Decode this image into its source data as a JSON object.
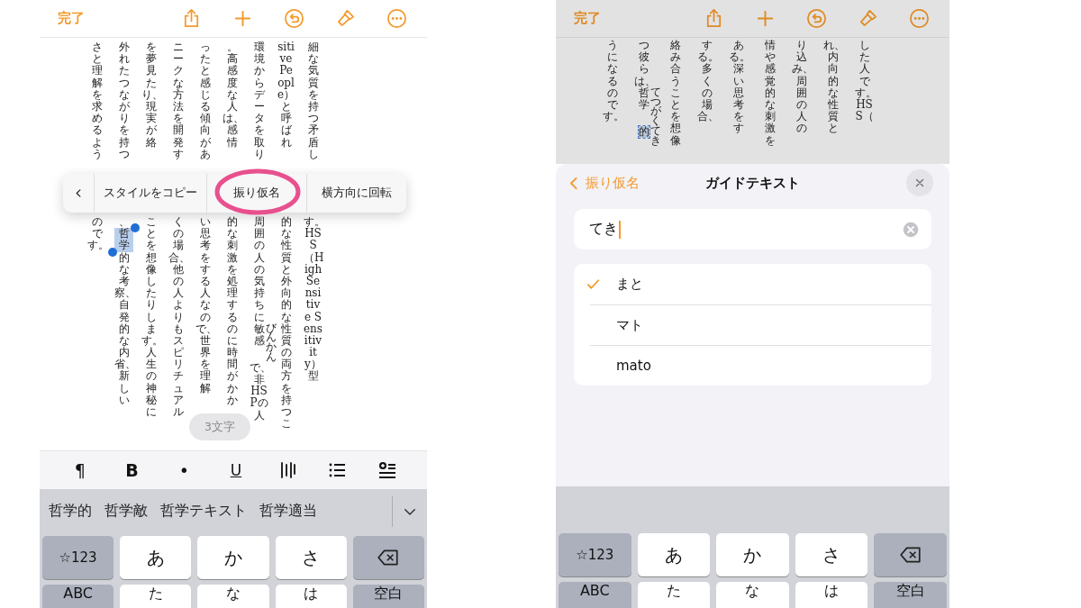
{
  "screens": [
    {
      "dimmed": false,
      "top_bar": {
        "done": "完了"
      },
      "document": {
        "columns": [
          {
            "top": [
              {
                "text": "さと理解を求めるよう"
              }
            ],
            "bottom": [
              {
                "text": "のです。"
              }
            ]
          },
          {
            "top": [
              {
                "text": "外れたつながりを持つ"
              }
            ],
            "bottom": [
              {
                "text": "、",
                "selected": false
              },
              {
                "text": "哲学",
                "selected": true
              },
              {
                "text": "的な考察、自発的な内省、新しい",
                "selected": false
              }
            ]
          },
          {
            "top": [
              {
                "text": "を夢見たり、現実が絡"
              }
            ],
            "bottom": [
              {
                "text": "ことを想像したりします。人生の神秘に"
              }
            ]
          },
          {
            "top": [
              {
                "text": "ニークな方法を開発す"
              }
            ],
            "bottom": [
              {
                "text": "くの場合、他の人よりもスピリチュアル"
              }
            ]
          },
          {
            "top": [
              {
                "text": "ったと感じる傾向があ"
              }
            ],
            "bottom": [
              {
                "text": "い思考をする人なので、世界を理解"
              }
            ]
          },
          {
            "top": [
              {
                "text": "。高感度な人は、感情"
              }
            ],
            "bottom": [
              {
                "text": "的な刺激を処理するのに時間がかか"
              }
            ]
          },
          {
            "top": [
              {
                "text": "環境からデータを取り"
              }
            ],
            "bottom": [
              {
                "text": "周囲の人の気持ちに"
              },
              {
                "text": "敏感",
                "ruby": "びんかん"
              },
              {
                "text": "で、非HSPの人"
              }
            ]
          },
          {
            "top": [
              {
                "text": "sitive People）と呼ばれ"
              }
            ],
            "bottom": [
              {
                "text": "的な性質と外向的な性質の両方を持つこ"
              }
            ]
          },
          {
            "top": [
              {
                "text": "細な気質を持つ矛盾し"
              }
            ],
            "bottom": [
              {
                "text": "す。HSS（High Sensitive Sensitivity）型"
              }
            ]
          }
        ]
      },
      "popup_menu": {
        "items": [
          "スタイルをコピー",
          "振り仮名",
          "横方向に回転"
        ]
      },
      "character_count": "3文字",
      "format_toolbar": [
        "¶",
        "B",
        "•",
        "U"
      ],
      "candidates": [
        "哲学的",
        "哲学敵",
        "哲学テキスト",
        "哲学適当"
      ],
      "keyboard": [
        [
          {
            "kind": "function",
            "label": "☆123"
          },
          {
            "kind": "char",
            "label": "あ"
          },
          {
            "kind": "char",
            "label": "か"
          },
          {
            "kind": "char",
            "label": "さ"
          },
          {
            "kind": "delete"
          }
        ],
        [
          {
            "kind": "function",
            "label": "ABC"
          },
          {
            "kind": "char",
            "label": "た"
          },
          {
            "kind": "char",
            "label": "な"
          },
          {
            "kind": "char",
            "label": "は"
          },
          {
            "kind": "function",
            "label": "空白"
          }
        ]
      ]
    },
    {
      "dimmed": true,
      "top_bar": {
        "done": "完了"
      },
      "document": {
        "columns": [
          {
            "top": [
              {
                "text": "うになるのです。"
              }
            ]
          },
          {
            "top": [
              {
                "text": "つ彼らは、",
                "selected": false
              },
              {
                "text": "哲学",
                "ruby": "てつがく",
                "selected": false
              },
              {
                "text": "的",
                "ruby": "てき",
                "selected": true
              }
            ]
          },
          {
            "top": [
              {
                "text": "絡み合うことを想像"
              }
            ]
          },
          {
            "top": [
              {
                "text": "する。多くの場合、"
              }
            ]
          },
          {
            "top": [
              {
                "text": "ある。深い思考をす"
              }
            ]
          },
          {
            "top": [
              {
                "text": "情や感覚的な刺激を"
              }
            ]
          },
          {
            "top": [
              {
                "text": "り込み、周囲の人の"
              }
            ]
          },
          {
            "top": [
              {
                "text": "れ、内向的な性質と"
              }
            ]
          },
          {
            "top": [
              {
                "text": "した人です。HSS（"
              }
            ]
          }
        ]
      },
      "sheet": {
        "back": "振り仮名",
        "title": "ガイドテキスト",
        "field_value": "てき",
        "options": [
          {
            "label": "まと",
            "selected": true
          },
          {
            "label": "マト",
            "selected": false
          },
          {
            "label": "mato",
            "selected": false
          }
        ]
      },
      "keyboard": [
        [
          {
            "kind": "function",
            "label": "☆123"
          },
          {
            "kind": "char",
            "label": "あ"
          },
          {
            "kind": "char",
            "label": "か"
          },
          {
            "kind": "char",
            "label": "さ"
          },
          {
            "kind": "delete"
          }
        ],
        [
          {
            "kind": "function",
            "label": "ABC"
          },
          {
            "kind": "char",
            "label": "た"
          },
          {
            "kind": "char",
            "label": "な"
          },
          {
            "kind": "char",
            "label": "は"
          },
          {
            "kind": "function",
            "label": "空白"
          }
        ]
      ]
    }
  ]
}
